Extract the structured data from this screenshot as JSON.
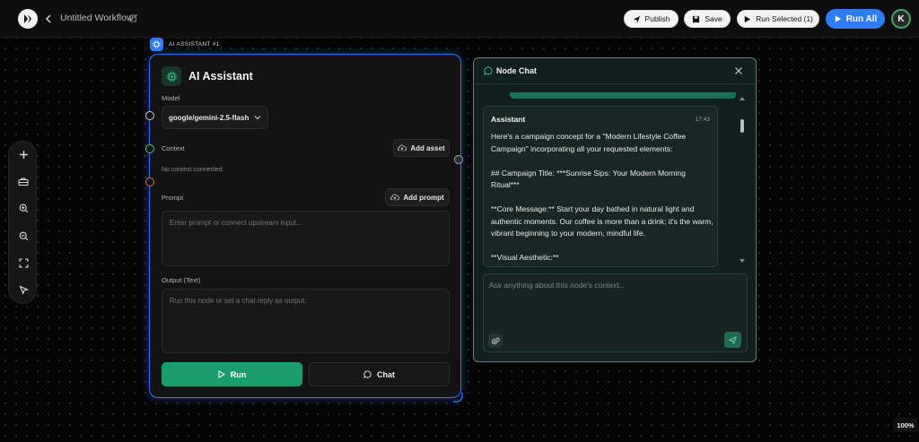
{
  "header": {
    "workflow_title": "Untitled Workflow",
    "publish_label": "Publish",
    "save_label": "Save",
    "run_selected_label": "Run Selected (1)",
    "run_all_label": "Run All",
    "avatar_initial": "K"
  },
  "node": {
    "tag": "AI ASSISTANT #1",
    "title": "AI Assistant",
    "model_label": "Model",
    "model_value": "google/gemini-2.5-flash",
    "context_label": "Context",
    "add_asset_label": "Add asset",
    "context_empty": "No context connected",
    "prompt_label": "Prompt",
    "add_prompt_label": "Add prompt",
    "prompt_placeholder": "Enter prompt or connect upstream input...",
    "output_label": "Output (Text)",
    "output_placeholder": "Run this node or set a chat reply as output.",
    "run_label": "Run",
    "chat_label": "Chat"
  },
  "chat": {
    "title": "Node Chat",
    "message": {
      "author": "Assistant",
      "time": "17:43",
      "paragraphs": [
        "Here's a campaign concept for a \"Modern Lifestyle Coffee Campaign\" incorporating all your requested elements:",
        "## Campaign Title: ***Sunrise Sips: Your Modern Morning Ritual***",
        "**Core Message:** Start your day bathed in natural light and authentic moments. Our coffee is more than a drink; it's the warm, vibrant beginning to your modern, mindful life.",
        "**Visual Aesthetic:**"
      ]
    },
    "input_placeholder": "Ask anything about this node's context..."
  },
  "zoom_level": "100%",
  "colors": {
    "accent_blue": "#2f7cf6",
    "run_green": "#1a9c6f",
    "node_border": "#2f6df0"
  }
}
